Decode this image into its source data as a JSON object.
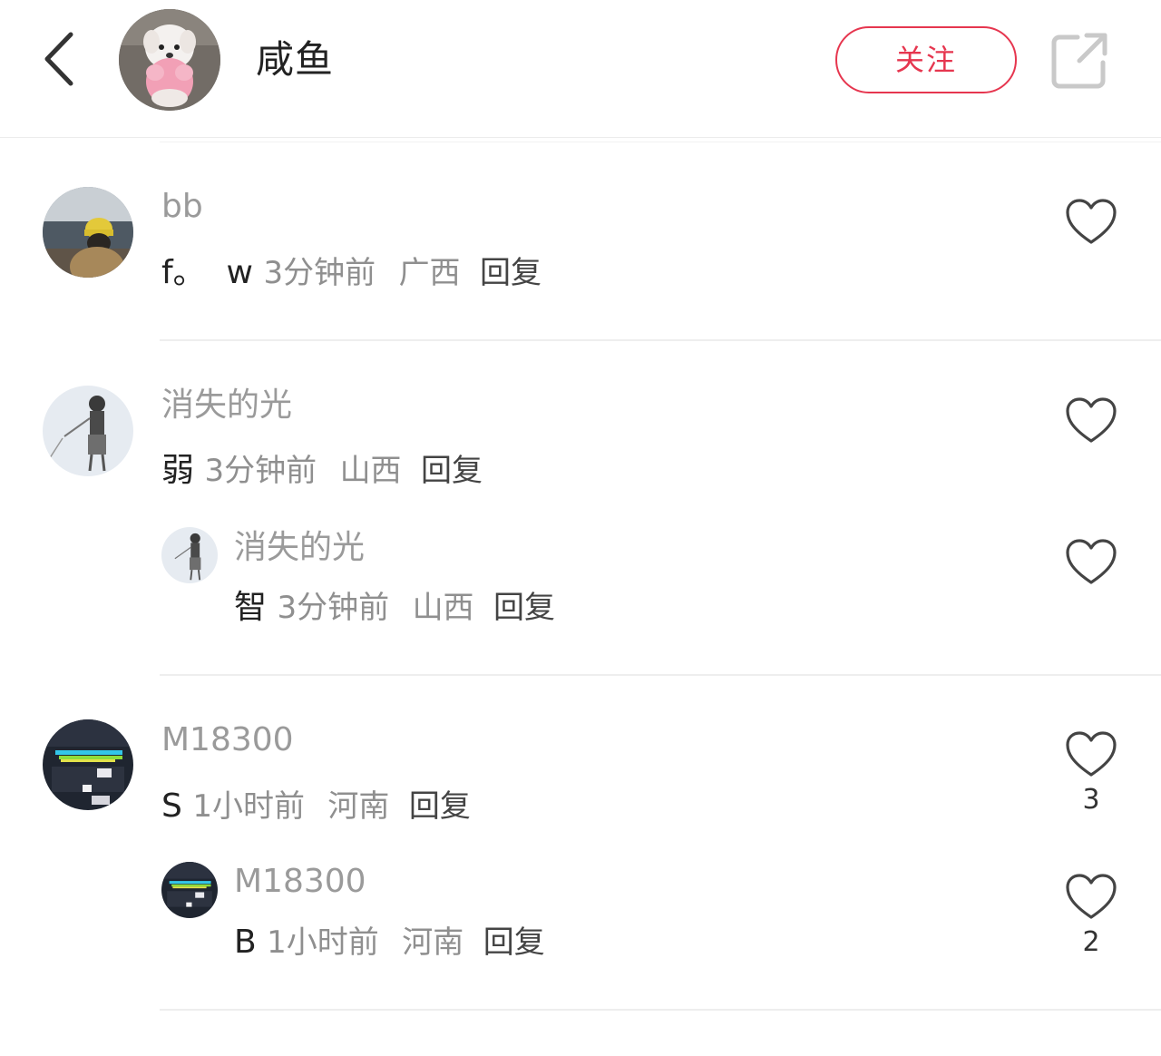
{
  "header": {
    "back_icon": "chevron-left-icon",
    "user_name": "咸鱼",
    "follow_label": "关注",
    "share_icon": "share-external-icon",
    "accent_color": "#e6364f"
  },
  "comments": [
    {
      "username": "bb",
      "content": "f。  w",
      "time": "3分钟前",
      "region": "广西",
      "reply_label": "回复",
      "like_count": ""
    },
    {
      "username": "消失的光",
      "content": "弱",
      "time": "3分钟前",
      "region": "山西",
      "reply_label": "回复",
      "like_count": "",
      "replies": [
        {
          "username": "消失的光",
          "content": "智",
          "time": "3分钟前",
          "region": "山西",
          "reply_label": "回复",
          "like_count": ""
        }
      ]
    },
    {
      "username": "M18300",
      "content": "S",
      "time": "1小时前",
      "region": "河南",
      "reply_label": "回复",
      "like_count": "3",
      "replies": [
        {
          "username": "M18300",
          "content": "B",
          "time": "1小时前",
          "region": "河南",
          "reply_label": "回复",
          "like_count": "2"
        }
      ]
    }
  ]
}
